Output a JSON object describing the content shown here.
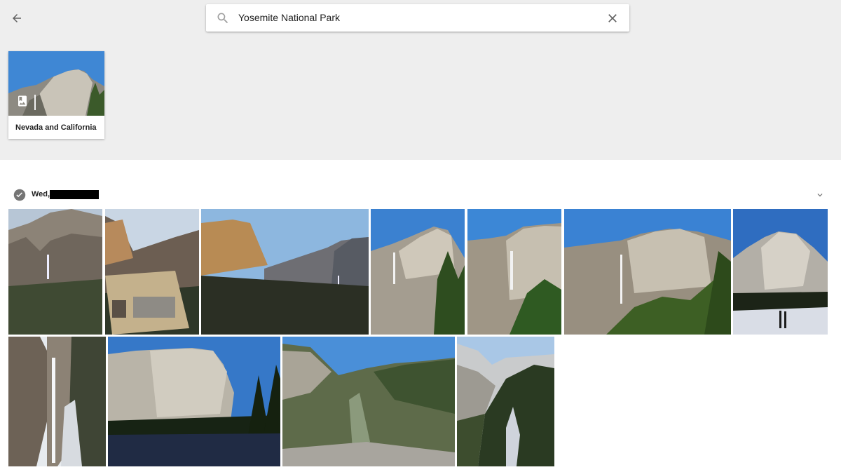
{
  "header": {
    "back_icon": "arrow-back-icon",
    "search": {
      "value": "Yosemite National Park",
      "search_icon": "search-icon",
      "clear_icon": "close-icon"
    }
  },
  "albums": [
    {
      "title": "Nevada and California",
      "badge_icon": "photo-album-icon"
    }
  ],
  "section": {
    "date_label": "Wed,",
    "select_icon": "check-circle-icon",
    "collapse_icon": "chevron-down-icon"
  },
  "colors": {
    "page_top_bg": "#eeeeee",
    "content_bg": "#ffffff",
    "sky_blue": "#3d86d6",
    "text_primary": "#212121"
  }
}
